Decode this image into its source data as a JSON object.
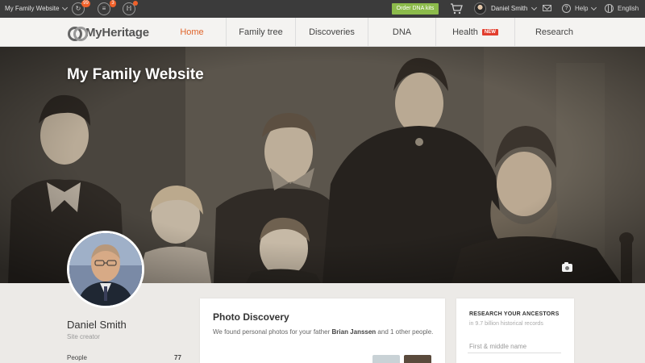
{
  "topbar": {
    "site_name": "My Family Website",
    "icons": [
      {
        "name": "activity-icon",
        "glyph": "↻",
        "badge": "99"
      },
      {
        "name": "inbox-icon",
        "glyph": "≡",
        "badge": "3"
      },
      {
        "name": "matches-icon",
        "glyph": "ℍ",
        "badge": ""
      }
    ],
    "dna_button": "Order DNA kits",
    "user_name": "Daniel Smith",
    "help": "Help",
    "language": "English"
  },
  "nav": {
    "logo": "MyHeritage",
    "items": [
      {
        "label": "Home",
        "active": true
      },
      {
        "label": "Family tree",
        "active": false
      },
      {
        "label": "Discoveries",
        "active": false
      },
      {
        "label": "DNA",
        "active": false
      },
      {
        "label": "Health",
        "active": false,
        "tag": "NEW"
      },
      {
        "label": "Research",
        "active": false
      }
    ]
  },
  "hero": {
    "title": "My Family Website"
  },
  "profile": {
    "name": "Daniel Smith",
    "role": "Site creator",
    "stats": [
      {
        "label": "People",
        "value": "77"
      }
    ]
  },
  "photo_discovery": {
    "title": "Photo Discovery",
    "text_before": "We found personal photos for your father ",
    "highlight": "Brian Janssen",
    "text_after": " and 1 other people."
  },
  "research": {
    "title": "RESEARCH YOUR ANCESTORS",
    "subtitle": "in 9.7 billion historical records",
    "first_name_placeholder": "First & middle name"
  },
  "colors": {
    "accent": "#e0642a",
    "dna_button": "#8cbb4b",
    "badge": "#f0612a",
    "new_tag": "#e23e2e",
    "topbar": "#3b3b3b"
  }
}
